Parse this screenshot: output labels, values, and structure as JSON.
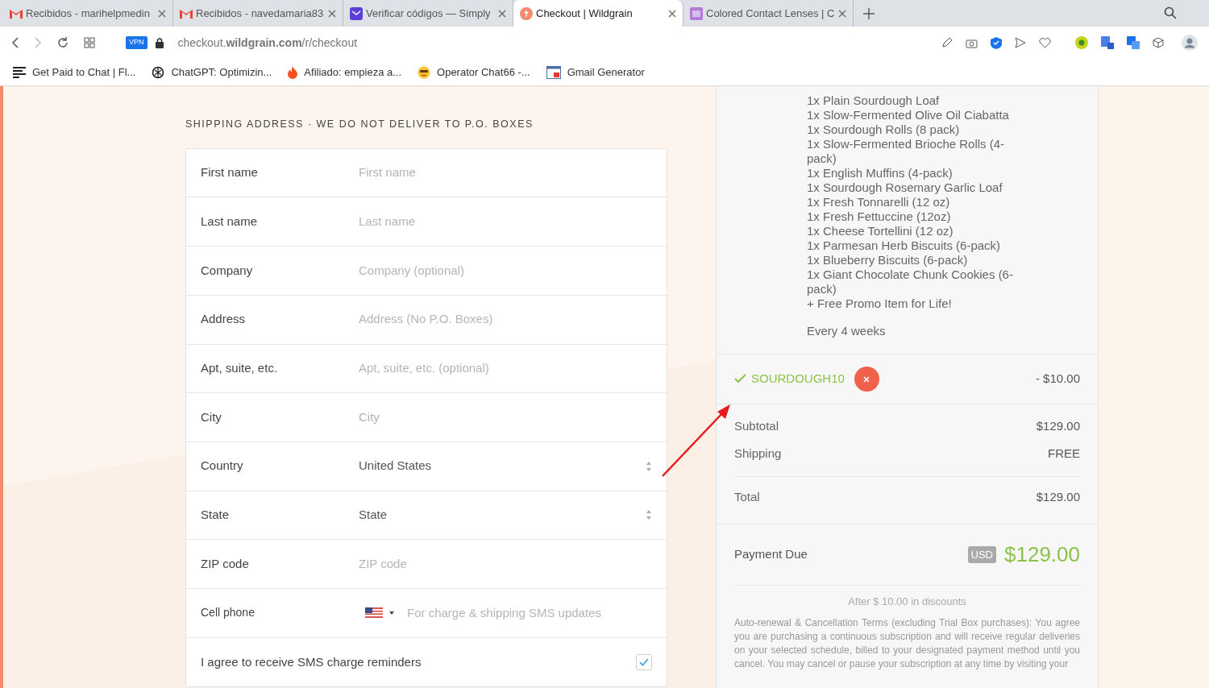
{
  "browser": {
    "tabs": [
      {
        "title": "Recibidos - marihelpmedin",
        "selected": false
      },
      {
        "title": "Recibidos - navedamaria83",
        "selected": false
      },
      {
        "title": "Verificar códigos — Simply",
        "selected": false
      },
      {
        "title": "Checkout | Wildgrain",
        "selected": true
      },
      {
        "title": "Colored Contact Lenses | C",
        "selected": false
      }
    ],
    "vpn_badge": "VPN",
    "address": "checkout.**wildgrain.com**/r/checkout",
    "bookmarks": [
      {
        "title": "Get Paid to Chat | Fl..."
      },
      {
        "title": "ChatGPT: Optimizin..."
      },
      {
        "title": "Afiliado: empieza a..."
      },
      {
        "title": "Operator Chat66 -..."
      },
      {
        "title": "Gmail Generator"
      }
    ]
  },
  "shipping": {
    "heading": "SHIPPING ADDRESS · WE DO NOT DELIVER TO P.O. BOXES",
    "fields": [
      {
        "kind": "text",
        "label": "First name",
        "placeholder": "First name"
      },
      {
        "kind": "text",
        "label": "Last name",
        "placeholder": "Last name"
      },
      {
        "kind": "text",
        "label": "Company",
        "placeholder": "Company (optional)"
      },
      {
        "kind": "text",
        "label": "Address",
        "placeholder": "Address (No P.O. Boxes)"
      },
      {
        "kind": "text",
        "label": "Apt, suite, etc.",
        "placeholder": "Apt, suite, etc. (optional)"
      },
      {
        "kind": "text",
        "label": "City",
        "placeholder": "City"
      },
      {
        "kind": "select",
        "label": "Country",
        "value": "United States"
      },
      {
        "kind": "select",
        "label": "State",
        "value": "State"
      },
      {
        "kind": "text",
        "label": "ZIP code",
        "placeholder": "ZIP code"
      },
      {
        "kind": "phone",
        "label": "Cell phone",
        "placeholder": "For charge & shipping SMS updates"
      },
      {
        "kind": "checkbox",
        "label": "I agree to receive SMS charge reminders",
        "checked": true
      }
    ]
  },
  "order": {
    "items": [
      "1x Plain Sourdough Loaf",
      "1x Slow-Fermented Olive Oil Ciabatta",
      "1x Sourdough Rolls (8 pack)",
      "1x Slow-Fermented Brioche Rolls (4-pack)",
      "1x English Muffins (4-pack)",
      "1x Sourdough Rosemary Garlic Loaf",
      "1x Fresh Tonnarelli (12 oz)",
      "1x Fresh Fettuccine (12oz)",
      "1x Cheese Tortellini (12 oz)",
      "1x Parmesan Herb Biscuits (6-pack)",
      "1x Blueberry Biscuits (6-pack)",
      "1x Giant Chocolate Chunk Cookies (6-pack)",
      "+ Free Promo Item for Life!"
    ],
    "frequency": "Every 4 weeks",
    "coupon": {
      "code": "SOURDOUGH10",
      "amount": "- $10.00"
    },
    "summary": [
      {
        "label": "Subtotal",
        "value": "$129.00"
      },
      {
        "label": "Shipping",
        "value": "FREE"
      }
    ],
    "total": {
      "label": "Total",
      "value": "$129.00"
    },
    "payment_due": {
      "label": "Payment Due",
      "currency": "USD",
      "amount": "$129.00"
    },
    "discount_note": "After $ 10.00 in discounts",
    "terms": "Auto-renewal & Cancellation Terms (excluding Trial Box purchases): You agree you are purchasing a continuous subscription and will receive regular deliveries on your selected schedule, billed to your designated payment method until you cancel. You may cancel or pause your subscription at any time by visiting your"
  }
}
